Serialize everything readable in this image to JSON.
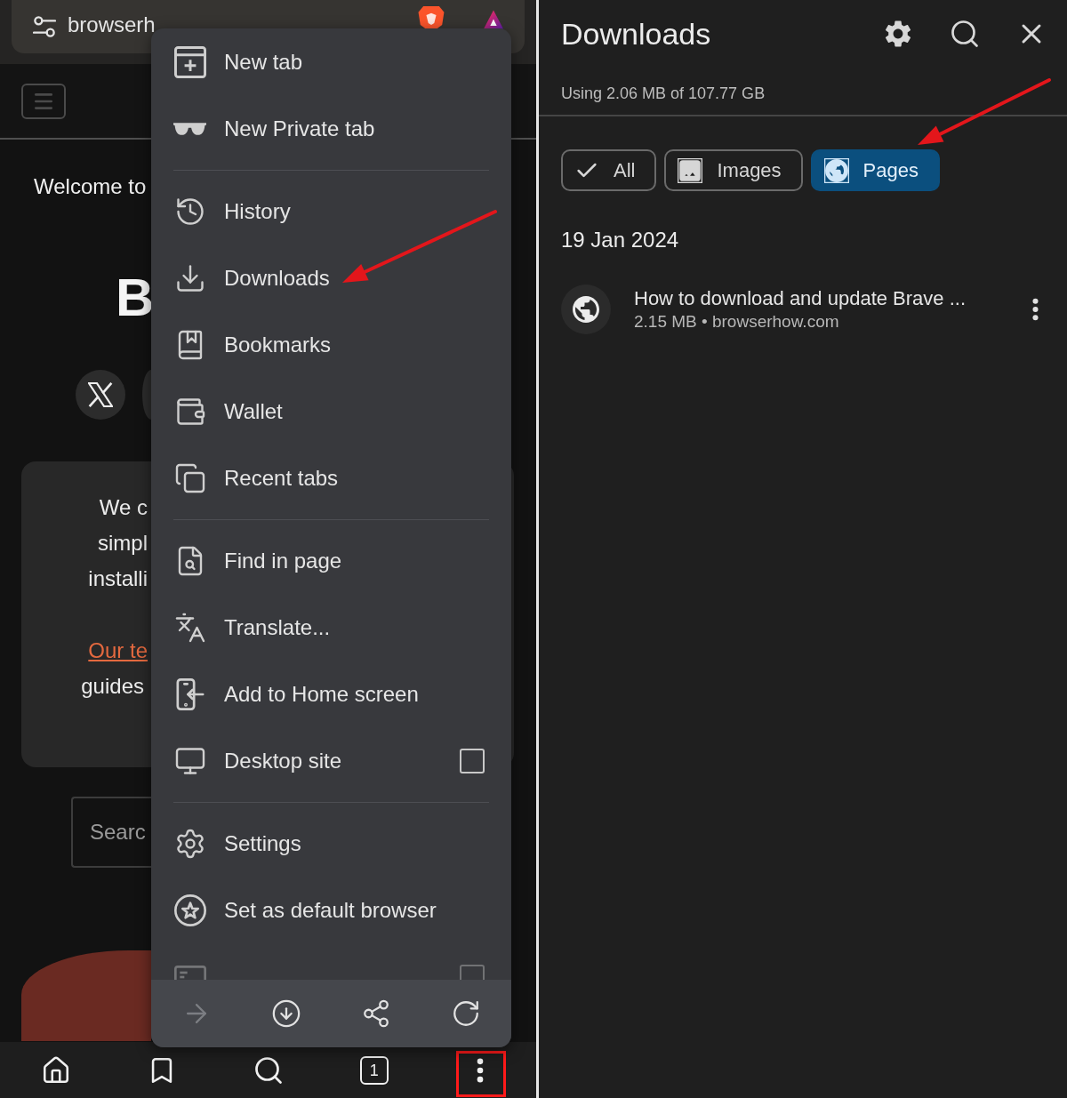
{
  "browser": {
    "address_bar": {
      "url": "browserh"
    },
    "page": {
      "welcome": "Welcome to",
      "heading": "B",
      "card_lines": [
        "We c",
        "simpl",
        "installi"
      ],
      "card_link": "Our te",
      "card_after": "guides",
      "search": {
        "placeholder": "Searc"
      }
    },
    "menu": {
      "sections": [
        [
          {
            "kind": "action",
            "label": "New tab"
          },
          {
            "kind": "action",
            "label": "New Private tab"
          }
        ],
        [
          {
            "kind": "action",
            "label": "History"
          },
          {
            "kind": "action",
            "label": "Downloads"
          },
          {
            "kind": "action",
            "label": "Bookmarks"
          },
          {
            "kind": "action",
            "label": "Wallet"
          },
          {
            "kind": "action",
            "label": "Recent tabs"
          }
        ],
        [
          {
            "kind": "action",
            "label": "Find in page"
          },
          {
            "kind": "action",
            "label": "Translate..."
          },
          {
            "kind": "action",
            "label": "Add to Home screen"
          },
          {
            "kind": "checkbox",
            "label": "Desktop site",
            "checked": false
          }
        ],
        [
          {
            "kind": "action",
            "label": "Settings"
          },
          {
            "kind": "action",
            "label": "Set as default browser"
          },
          {
            "kind": "checkbox",
            "checked": false
          }
        ]
      ],
      "action_bar": [
        {
          "disabled": true
        },
        {
          "disabled": false
        },
        {
          "disabled": false
        },
        {
          "disabled": false
        }
      ]
    },
    "bottom_nav": {
      "tab_count": "1"
    }
  },
  "downloads": {
    "title": "Downloads",
    "storage": "Using 2.06 MB of 107.77 GB",
    "chips": [
      {
        "label": "All",
        "selected": false
      },
      {
        "label": "Images",
        "selected": false
      },
      {
        "label": "Pages",
        "selected": true
      }
    ],
    "groups": [
      {
        "date": "19 Jan 2024",
        "items": [
          {
            "title": "How to download and update Brave ...",
            "meta": "2.15 MB • browserhow.com"
          }
        ]
      }
    ]
  }
}
